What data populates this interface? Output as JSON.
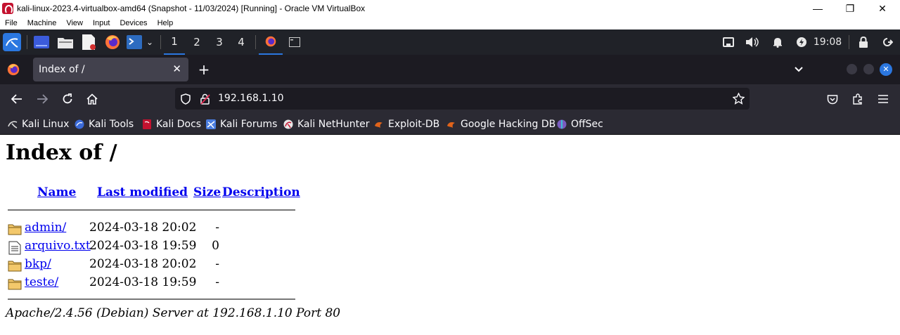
{
  "host_window": {
    "title": "kali-linux-2023.4-virtualbox-amd64 (Snapshot - 11/03/2024) [Running] - Oracle VM VirtualBox",
    "minimize": "—",
    "restore": "❐",
    "close": "✕"
  },
  "vbox_menu": [
    "File",
    "Machine",
    "View",
    "Input",
    "Devices",
    "Help"
  ],
  "kali_panel": {
    "workspaces": [
      "1",
      "2",
      "3",
      "4"
    ],
    "active_workspace": "1",
    "clock": "19:08",
    "icons": [
      "kali-menu-icon",
      "desktop-icon",
      "file-manager-icon",
      "text-editor-icon",
      "firefox-icon",
      "terminal-icon",
      "network-icon",
      "volume-icon",
      "notifications-icon",
      "power-icon",
      "lock-icon",
      "logout-icon"
    ]
  },
  "firefox": {
    "tab_title": "Index of /",
    "tab_close": "✕",
    "new_tab": "+",
    "url": "192.168.1.10",
    "bookmarks": [
      {
        "label": "Kali Linux",
        "color": "#dddddd"
      },
      {
        "label": "Kali Tools",
        "color": "#3b6ad8"
      },
      {
        "label": "Kali Docs",
        "color": "#c4122f"
      },
      {
        "label": "Kali Forums",
        "color": "#4a7de0"
      },
      {
        "label": "Kali NetHunter",
        "color": "#c4122f"
      },
      {
        "label": "Exploit-DB",
        "color": "#e0631a"
      },
      {
        "label": "Google Hacking DB",
        "color": "#e0631a"
      },
      {
        "label": "OffSec",
        "color": "#7a5cc0"
      }
    ]
  },
  "page": {
    "heading": "Index of /",
    "columns": {
      "name": "Name",
      "last_modified": "Last modified",
      "size": "Size",
      "description": "Description"
    },
    "rows": [
      {
        "name": "admin/",
        "date": "2024-03-18 20:02",
        "size": "-",
        "icon": "folder-icon"
      },
      {
        "name": "arquivo.txt",
        "date": "2024-03-18 19:59",
        "size": "0",
        "icon": "text-file-icon"
      },
      {
        "name": "bkp/",
        "date": "2024-03-18 20:02",
        "size": "-",
        "icon": "folder-icon"
      },
      {
        "name": "teste/",
        "date": "2024-03-18 19:59",
        "size": "-",
        "icon": "folder-icon"
      }
    ],
    "address": "Apache/2.4.56 (Debian) Server at 192.168.1.10 Port 80"
  }
}
